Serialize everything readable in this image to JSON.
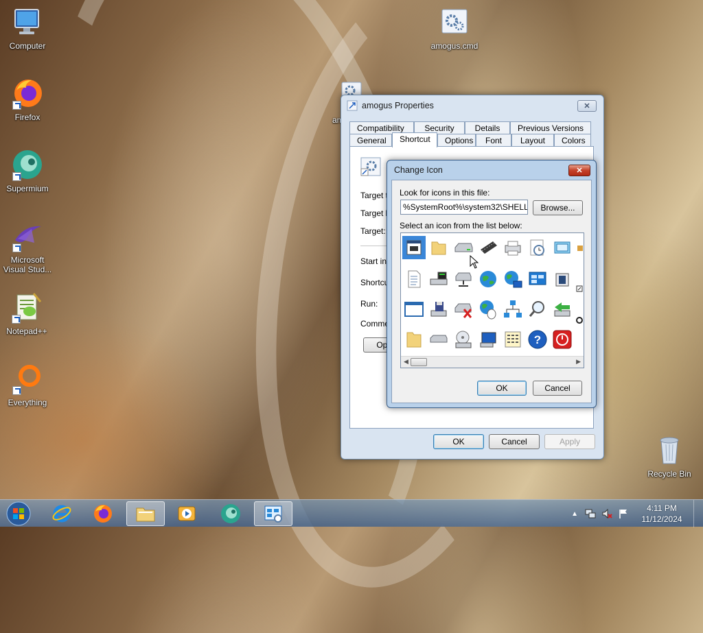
{
  "desktop": {
    "icons": [
      {
        "label": "Computer"
      },
      {
        "label": "Firefox"
      },
      {
        "label": "Supermium"
      },
      {
        "label": "Microsoft Visual Stud..."
      },
      {
        "label": "Notepad++"
      },
      {
        "label": "Everything"
      },
      {
        "label": "amogus.cmd"
      },
      {
        "label": "Recycle Bin"
      }
    ],
    "partial_icon_label": "am"
  },
  "properties_window": {
    "title": "amogus Properties",
    "close": "✕",
    "tabs_row1": [
      "Compatibility",
      "Security",
      "Details",
      "Previous Versions"
    ],
    "tabs_row2": [
      "General",
      "Shortcut",
      "Options",
      "Font",
      "Layout",
      "Colors"
    ],
    "selected_tab": "Shortcut",
    "field_labels": [
      "Target ty",
      "Target lo",
      "Target:",
      "Start in:",
      "Shortcut",
      "Run:",
      "Commen"
    ],
    "open_button_partial": "Ope",
    "ok": "OK",
    "cancel": "Cancel",
    "apply": "Apply"
  },
  "change_icon_dialog": {
    "title": "Change Icon",
    "close": "✕",
    "look_label": "Look for icons in this file:",
    "path_value": "%SystemRoot%\\system32\\SHELL32",
    "browse": "Browse...",
    "list_label": "Select an icon from the list below:",
    "icons": [
      [
        "document-icon",
        "folder-icon",
        "drive-icon",
        "memory-chip-icon",
        "printer-icon",
        "clock-icon",
        "window-icon"
      ],
      [
        "text-file-icon",
        "terminal-icon",
        "network-drive-icon",
        "globe-icon",
        "network-globe-icon",
        "network-panel-icon",
        "camera-icon"
      ],
      [
        "blank-window-icon",
        "floppy-icon",
        "drive-error-icon",
        "mouse-globe-icon",
        "network-tree-icon",
        "search-icon",
        "drive-arrow-icon"
      ],
      [
        "folder-icon",
        "disk-drive-icon",
        "cd-drive-icon",
        "monitor-icon",
        "grid-window-icon",
        "help-icon",
        "power-icon"
      ]
    ],
    "ok": "OK",
    "cancel": "Cancel"
  },
  "taskbar": {
    "apps": [
      "internet-explorer-icon",
      "firefox-icon",
      "file-explorer-icon",
      "media-player-icon",
      "supermium-icon",
      "control-panel-icon"
    ],
    "time": "4:11 PM",
    "date": "11/12/2024"
  },
  "colors": {
    "accent": "#3a86d8",
    "close_red": "#c4412a",
    "taskbar": "#4a6a90"
  }
}
